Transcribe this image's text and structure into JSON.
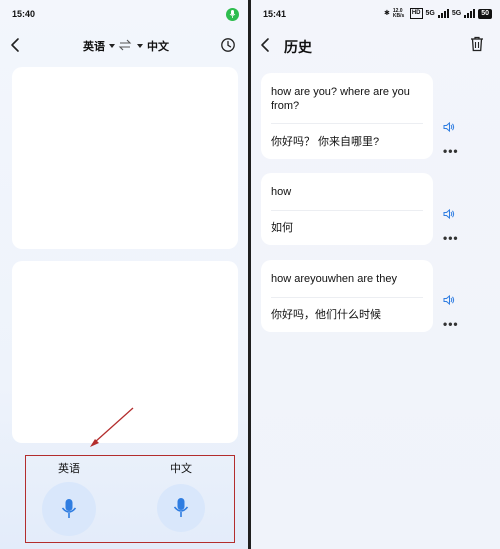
{
  "left_screen": {
    "status_time": "15:40",
    "source_language": "英语",
    "target_language": "中文",
    "voice_buttons": [
      {
        "label": "英语"
      },
      {
        "label": "中文"
      }
    ],
    "colors": {
      "accent": "#2f7de1",
      "mic_bg": "#d9e7fb",
      "annotation": "#b32d2d",
      "mic_status": "#2dbd4e"
    }
  },
  "right_screen": {
    "status_time": "15:41",
    "status_icons": [
      "bluetooth-icon",
      "12.0 KB/s",
      "HD",
      "5G",
      "5G",
      "50"
    ],
    "title": "历史",
    "history": [
      {
        "source": "how are you?  where are you from?",
        "translation": "你好吗？ 你来自哪里?"
      },
      {
        "source": "how",
        "translation": "如何"
      },
      {
        "source": "how areyouwhen are they",
        "translation": "你好吗，他们什么时候"
      }
    ],
    "more_label": "•••"
  }
}
